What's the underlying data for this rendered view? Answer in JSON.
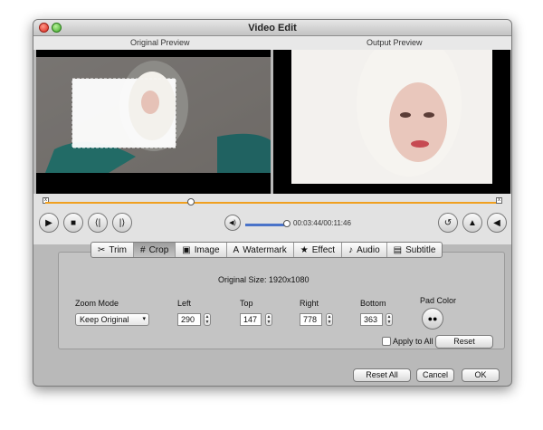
{
  "window": {
    "title": "Video Edit"
  },
  "previews": {
    "original_label": "Original Preview",
    "output_label": "Output Preview"
  },
  "timeline": {
    "start_marker": "x",
    "end_marker": "x",
    "progress": 0.32
  },
  "playback": {
    "play_icon": "▶",
    "stop_icon": "■",
    "prev_icon": "⟨|",
    "next_icon": "|⟩",
    "volume_icon": "◀)",
    "volume_level": 0.68,
    "time": "00:03:44/00:11:46",
    "rotate_icon": "↺",
    "flip_v_icon": "▲",
    "flip_h_icon": "◀"
  },
  "tabs": [
    {
      "label": "Trim",
      "icon": "✂"
    },
    {
      "label": "Crop",
      "icon": "#"
    },
    {
      "label": "Image",
      "icon": "▣"
    },
    {
      "label": "Watermark",
      "icon": "A"
    },
    {
      "label": "Effect",
      "icon": "★"
    },
    {
      "label": "Audio",
      "icon": "♪"
    },
    {
      "label": "Subtitle",
      "icon": "▤"
    }
  ],
  "selected_tab": "Crop",
  "crop": {
    "original_size": "Original Size: 1920x1080",
    "zoom_mode_label": "Zoom Mode",
    "zoom_mode_value": "Keep Original",
    "left_label": "Left",
    "left_value": "290",
    "top_label": "Top",
    "top_value": "147",
    "right_label": "Right",
    "right_value": "778",
    "bottom_label": "Bottom",
    "bottom_value": "363",
    "pad_color_label": "Pad Color",
    "apply_to_all_label": "Apply to All",
    "apply_to_all_checked": false,
    "reset_label": "Reset"
  },
  "footer": {
    "reset_all_label": "Reset All",
    "cancel_label": "Cancel",
    "ok_label": "OK"
  },
  "colors": {
    "accent_track": "#f0a020",
    "volume": "#4a73c9",
    "selected_tab": "#a8a8a8"
  }
}
